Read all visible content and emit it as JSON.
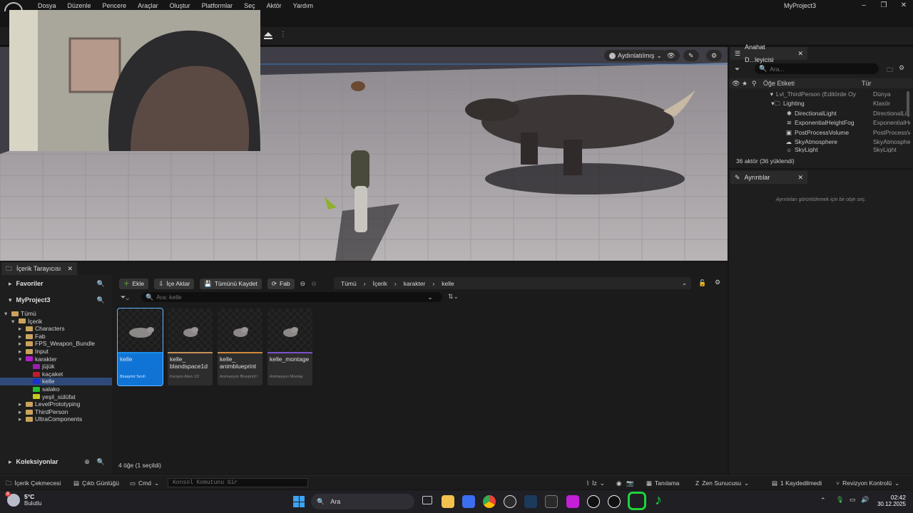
{
  "menu": [
    "Dosya",
    "Düzenle",
    "Pencere",
    "Araçlar",
    "Oluştur",
    "Platformlar",
    "Seç",
    "Aktör",
    "Yardım"
  ],
  "app_title": "MyProject3",
  "viewport": {
    "lighting_mode": "Aydınlatılmış"
  },
  "outliner": {
    "tab_label": "Anahat D...leyicisi",
    "search_placeholder": "Ara...",
    "col_label": "Öğe Etiketi",
    "col_type": "Tür",
    "rows": [
      {
        "label": "Lvl_ThirdPerson (Editörde Oy",
        "type": "Dünya"
      },
      {
        "label": "Lighting",
        "type": "Klasör"
      },
      {
        "label": "DirectionalLight",
        "type": "DirectionalLig"
      },
      {
        "label": "ExponentialHeightFog",
        "type": "ExponentialHe"
      },
      {
        "label": "PostProcessVolume",
        "type": "PostProcessV"
      },
      {
        "label": "SkyAtmosphere",
        "type": "SkyAtmosphere"
      },
      {
        "label": "SkyLight",
        "type": "SkyLight"
      }
    ],
    "actor_count": "36 aktör (36 yüklendi)"
  },
  "details": {
    "tab_label": "Ayrıntılar",
    "hint": "Ayrıntıları görüntülemek için bir obje seç."
  },
  "content_browser": {
    "tab_label": "İçerik Tarayıcısı",
    "favorites": "Favoriler",
    "project": "MyProject3",
    "collections": "Koleksiyonlar",
    "buttons": {
      "add": "Ekle",
      "import": "İçe Aktar",
      "save_all": "Tümünü Kaydet",
      "fab": "Fab"
    },
    "breadcrumb": [
      "Tümü",
      "İçerik",
      "karakter",
      "kelle"
    ],
    "search_placeholder": "Ara: kelle",
    "tree": [
      {
        "label": "Tümü",
        "depth": 0,
        "color": "#c9a35c"
      },
      {
        "label": "İçerik",
        "depth": 1,
        "color": "#c9a35c"
      },
      {
        "label": "Characters",
        "depth": 2,
        "color": "#c9a35c"
      },
      {
        "label": "Fab",
        "depth": 2,
        "color": "#c9a35c"
      },
      {
        "label": "FPS_Weapon_Bundle",
        "depth": 2,
        "color": "#c9a35c"
      },
      {
        "label": "Input",
        "depth": 2,
        "color": "#c9a35c"
      },
      {
        "label": "karakter",
        "depth": 2,
        "color": "#b21fc9"
      },
      {
        "label": "jüjük",
        "depth": 3,
        "color": "#9a1fb0"
      },
      {
        "label": "kaçaket",
        "depth": 3,
        "color": "#c01c2a"
      },
      {
        "label": "kelle",
        "depth": 3,
        "color": "#1c2fd6"
      },
      {
        "label": "salako",
        "depth": 3,
        "color": "#25c02a"
      },
      {
        "label": "yeşil_sülüfat",
        "depth": 3,
        "color": "#c6c81e"
      },
      {
        "label": "LevelPrototyping",
        "depth": 2,
        "color": "#c9a35c"
      },
      {
        "label": "ThirdPerson",
        "depth": 2,
        "color": "#c9a35c"
      },
      {
        "label": "UltraComponents",
        "depth": 2,
        "color": "#c9a35c"
      }
    ],
    "assets": [
      {
        "name": "kelle",
        "type": "Blueprint Sınıfı",
        "selected": true,
        "bar": "#1a8fe8"
      },
      {
        "name": "kelle_ blandspace1d",
        "type": "Karışım Alanı 1D",
        "selected": false,
        "bar": "#c7915a"
      },
      {
        "name": "kelle_ animblueprint",
        "type": "Animasyon Blueprint'i",
        "selected": false,
        "bar": "#d08a3b"
      },
      {
        "name": "kelle_montage",
        "type": "Animasyon Montajı",
        "selected": false,
        "bar": "#7a52c9"
      }
    ],
    "item_count": "4 öğe (1 seçildi)"
  },
  "statusbar": {
    "drawer": "İçerik Çekmecesi",
    "output_log": "Çıktı Günlüğü",
    "cmd": "Cmd",
    "console_placeholder": "Konsol Komutunu Gir",
    "trace": "İz",
    "diagnostics": "Tanılama",
    "zen": "Zen Sunucusu",
    "unsaved": "1 Kaydedilmedi",
    "revision": "Revizyon Kontrolü"
  },
  "taskbar": {
    "weather_badge": "8",
    "temperature": "5°C",
    "condition": "Bulutlu",
    "search": "Ara",
    "time": "02:42",
    "date": "30.12.2025"
  }
}
